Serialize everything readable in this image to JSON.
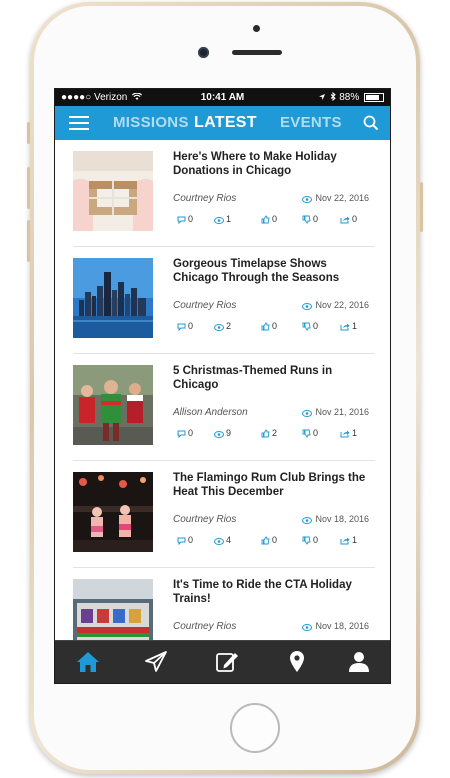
{
  "status_bar": {
    "carrier": "●●●●○ Verizon",
    "time": "10:41 AM",
    "battery": "88%"
  },
  "nav": {
    "tabs": [
      {
        "label": "MISSIONS",
        "partial": true
      },
      {
        "label": "LATEST",
        "active": true
      },
      {
        "label": "EVENTS",
        "partial": true
      }
    ]
  },
  "feed": {
    "items": [
      {
        "title": "Here's Where to Make Holiday Donations in Chicago",
        "author": "Courtney Rios",
        "date": "Nov 22, 2016",
        "comments": "0",
        "views": "1",
        "likes": "0",
        "dislikes": "0",
        "shares": "0"
      },
      {
        "title": "Gorgeous Timelapse Shows Chicago Through the Seasons",
        "author": "Courtney Rios",
        "date": "Nov 22, 2016",
        "comments": "0",
        "views": "2",
        "likes": "0",
        "dislikes": "0",
        "shares": "1"
      },
      {
        "title": "5 Christmas-Themed Runs in Chicago",
        "author": "Allison Anderson",
        "date": "Nov 21, 2016",
        "comments": "0",
        "views": "9",
        "likes": "2",
        "dislikes": "0",
        "shares": "1"
      },
      {
        "title": "The Flamingo Rum Club Brings the Heat This December",
        "author": "Courtney Rios",
        "date": "Nov 18, 2016",
        "comments": "0",
        "views": "4",
        "likes": "0",
        "dislikes": "0",
        "shares": "1"
      },
      {
        "title": "It's Time to Ride the CTA Holiday Trains!",
        "author": "Courtney Rios",
        "date": "Nov 18, 2016",
        "comments": "",
        "views": "",
        "likes": "",
        "dislikes": "",
        "shares": ""
      }
    ]
  },
  "tab_bar": {
    "icons": [
      "home-icon",
      "paper-plane-icon",
      "edit-icon",
      "map-pin-icon",
      "user-icon"
    ],
    "active": "home-icon"
  },
  "colors": {
    "accent": "#1f9ad6",
    "tab_bar_bg": "#2e2e2e",
    "stat_icon": "#1f9ad6"
  }
}
